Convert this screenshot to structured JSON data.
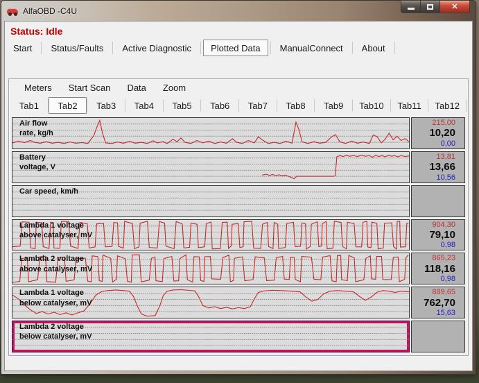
{
  "window": {
    "title": "AlfaOBD -C4U",
    "controls": {
      "minimize": "minimize",
      "maximize": "maximize",
      "close": "x"
    }
  },
  "status": {
    "text": "Status: Idle"
  },
  "menu": {
    "items": [
      "Start",
      "Status/Faults",
      "Active Diagnostic",
      "Plotted Data",
      "ManualConnect",
      "About"
    ],
    "selected_index": 3
  },
  "submenu": {
    "items": [
      "Meters",
      "Start Scan",
      "Data",
      "Zoom"
    ]
  },
  "tabs": {
    "items": [
      "Tab1",
      "Tab2",
      "Tab3",
      "Tab4",
      "Tab5",
      "Tab6",
      "Tab7",
      "Tab8",
      "Tab9",
      "Tab10",
      "Tab11",
      "Tab12"
    ],
    "selected_index": 1
  },
  "colors": {
    "trace": "#c62828",
    "max_value": "#c03030",
    "min_value": "#2222c4",
    "status_red": "#c00000",
    "selection": "#c81150"
  },
  "chart_data": [
    {
      "type": "line",
      "title": "Air flow rate, kg/h",
      "max": "215,00",
      "current": "10,20",
      "min": "0,00"
    },
    {
      "type": "line",
      "title": "Battery voltage, V",
      "max": "13,81",
      "current": "13,66",
      "min": "10,56"
    },
    {
      "type": "line",
      "title": "Car speed, km/h",
      "max": "",
      "current": "",
      "min": ""
    },
    {
      "type": "line",
      "title": "Lambda 1 voltage above catalyser, mV",
      "max": "904,30",
      "current": "79,10",
      "min": "0,98"
    },
    {
      "type": "line",
      "title": "Lambda 2 voltage above catalyser, mV",
      "max": "865,23",
      "current": "118,16",
      "min": "0,98"
    },
    {
      "type": "line",
      "title": "Lambda 1 voltage below catalyser, mV",
      "max": "889,65",
      "current": "762,70",
      "min": "15,63"
    },
    {
      "type": "line",
      "title": "Lambda 2 voltage below catalyser, mV",
      "max": "",
      "current": "",
      "min": ""
    }
  ],
  "plots": {
    "rows": [
      {
        "label1": "Air flow",
        "label2": "rate, kg/h",
        "max": "215,00",
        "current": "10,20",
        "min": "0,00",
        "selected": false,
        "wave": {
          "points": [
            0,
            82,
            1.5,
            76,
            3,
            81,
            4.5,
            74,
            5.5,
            80,
            7,
            83,
            8.5,
            78,
            10,
            83,
            11.5,
            80,
            13,
            84,
            14.5,
            79,
            16,
            83,
            17.5,
            81,
            19,
            84,
            20.5,
            58,
            21.3,
            30,
            22,
            8,
            22.7,
            50,
            23.5,
            82,
            25,
            84,
            26.5,
            79,
            28,
            83,
            29.5,
            77,
            31,
            83,
            32.5,
            80,
            34,
            84,
            35.5,
            75,
            36.5,
            82,
            38,
            78,
            39,
            84,
            40.5,
            70,
            41.5,
            78,
            42.5,
            66,
            43.5,
            80,
            45,
            84,
            46.5,
            74,
            48,
            82,
            49.5,
            76,
            51,
            84,
            52.5,
            79,
            54,
            83,
            55.5,
            68,
            56.5,
            80,
            58,
            84,
            59.5,
            74,
            61,
            82,
            62,
            62,
            63,
            72,
            64.5,
            84,
            66,
            80,
            67.5,
            84,
            69,
            76,
            70.5,
            83,
            71.5,
            14,
            72.3,
            40,
            73,
            78,
            74.5,
            84,
            76,
            78,
            77.5,
            83,
            79,
            80,
            80.5,
            62,
            81.5,
            55,
            82.5,
            78,
            84,
            84,
            85.5,
            76,
            87,
            83,
            88.5,
            79,
            90,
            84,
            91,
            56,
            92,
            62,
            93,
            82,
            94,
            70,
            95,
            50,
            96,
            72,
            97,
            60,
            98,
            74,
            99,
            68,
            100,
            78
          ]
        }
      },
      {
        "label1": "Battery",
        "label2": "voltage, V",
        "max": "13,81",
        "current": "13,66",
        "min": "10,56",
        "selected": false,
        "wave": {
          "points": [
            63,
            76,
            64,
            73,
            64.8,
            77,
            65.6,
            74,
            66.4,
            78,
            67.2,
            75,
            68,
            78,
            68.8,
            76,
            69.6,
            80,
            70.4,
            84,
            71,
            88,
            71.7,
            80,
            73,
            80,
            75,
            80,
            77,
            80,
            79,
            80,
            81,
            80,
            81.4,
            78,
            81.8,
            16,
            82.6,
            12,
            83.4,
            15,
            84.2,
            11,
            85,
            14,
            86,
            12,
            87,
            15,
            88,
            11,
            89,
            14,
            90,
            12,
            90.8,
            17,
            91.6,
            11,
            92.4,
            15,
            93.2,
            12,
            94,
            16,
            94.8,
            11,
            95.6,
            14,
            96.4,
            12,
            97.2,
            16,
            98,
            12,
            99,
            15,
            100,
            13
          ]
        }
      },
      {
        "label1": "Car speed, km/h",
        "label2": "",
        "max": "",
        "current": "",
        "min": "",
        "selected": false,
        "wave": null
      },
      {
        "label1": "Lambda 1 voltage",
        "label2": "above catalyser, mV",
        "max": "904,30",
        "current": "79,10",
        "min": "0,98",
        "selected": false,
        "wave": {
          "square": {
            "seed": 11,
            "min_cycle": 0.8,
            "max_cycle": 2.6,
            "top": [
              4,
              15
            ],
            "bottom": [
              85,
              96
            ]
          }
        }
      },
      {
        "label1": "Lambda 2 voltage",
        "label2": "above catalyser, mV",
        "max": "865,23",
        "current": "118,16",
        "min": "0,98",
        "selected": false,
        "wave": {
          "square": {
            "seed": 37,
            "min_cycle": 0.9,
            "max_cycle": 3.1,
            "top": [
              5,
              18
            ],
            "bottom": [
              84,
              96
            ]
          }
        }
      },
      {
        "label1": "Lambda 1 voltage",
        "label2": "below catalyser, mV",
        "max": "889,65",
        "current": "762,70",
        "min": "15,63",
        "selected": false,
        "wave": {
          "points": [
            0,
            26,
            1.5,
            38,
            3,
            58,
            4.5,
            74,
            6,
            86,
            7.5,
            80,
            9,
            88,
            10.5,
            82,
            12,
            90,
            13.5,
            84,
            15,
            91,
            16.5,
            84,
            18,
            78,
            19.5,
            55,
            21,
            26,
            22.5,
            14,
            24,
            11,
            26,
            9,
            28,
            11,
            29.5,
            13,
            30.5,
            30,
            31.5,
            62,
            32.5,
            88,
            34,
            95,
            36,
            93,
            37.2,
            60,
            38,
            28,
            39,
            13,
            40.5,
            9,
            42.5,
            8,
            44.5,
            10,
            46,
            12,
            47,
            32,
            48,
            60,
            49.5,
            68,
            51,
            64,
            52.5,
            70,
            54,
            66,
            55.5,
            71,
            57,
            67,
            58.5,
            70,
            60,
            64,
            61,
            38,
            62,
            17,
            63.5,
            12,
            65.5,
            10,
            68,
            11,
            70.5,
            13,
            72.5,
            15,
            74,
            32,
            75.5,
            46,
            77,
            40,
            78.5,
            22,
            80,
            13,
            82,
            11,
            84,
            13,
            86,
            15,
            87.5,
            30,
            89,
            43,
            90.5,
            32,
            92,
            16,
            93.5,
            11,
            95,
            13,
            96.5,
            17,
            98,
            13,
            100,
            15
          ]
        }
      },
      {
        "label1": "Lambda 2 voltage",
        "label2": "below catalyser, mV",
        "max": "",
        "current": "",
        "min": "",
        "selected": true,
        "wave": null
      }
    ]
  }
}
